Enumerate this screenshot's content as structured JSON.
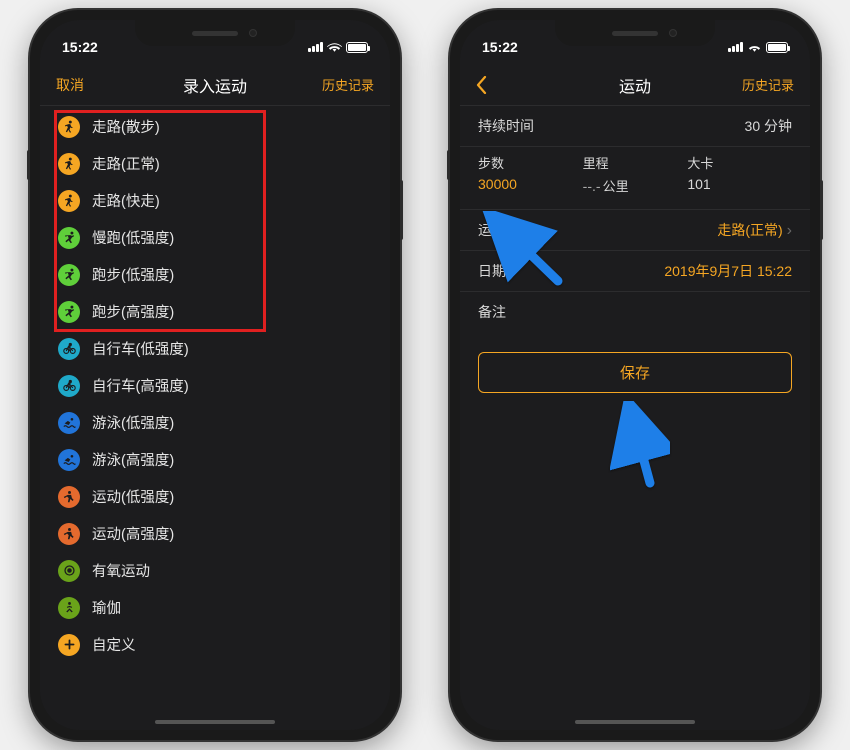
{
  "statusbar": {
    "time": "15:22",
    "location_dot": "↗"
  },
  "left": {
    "nav": {
      "cancel": "取消",
      "title": "录入运动",
      "history": "历史记录"
    },
    "items": [
      {
        "label": "走路(散步)",
        "color": "#f5a623",
        "glyph": "walk"
      },
      {
        "label": "走路(正常)",
        "color": "#f5a623",
        "glyph": "walk"
      },
      {
        "label": "走路(快走)",
        "color": "#f5a623",
        "glyph": "walk"
      },
      {
        "label": "慢跑(低强度)",
        "color": "#5fcf3a",
        "glyph": "run"
      },
      {
        "label": "跑步(低强度)",
        "color": "#5fcf3a",
        "glyph": "run"
      },
      {
        "label": "跑步(高强度)",
        "color": "#5fcf3a",
        "glyph": "run"
      },
      {
        "label": "自行车(低强度)",
        "color": "#1fa9c9",
        "glyph": "bike"
      },
      {
        "label": "自行车(高强度)",
        "color": "#1fa9c9",
        "glyph": "bike"
      },
      {
        "label": "游泳(低强度)",
        "color": "#2174d9",
        "glyph": "swim"
      },
      {
        "label": "游泳(高强度)",
        "color": "#2174d9",
        "glyph": "swim"
      },
      {
        "label": "运动(低强度)",
        "color": "#e46a2e",
        "glyph": "exercise"
      },
      {
        "label": "运动(高强度)",
        "color": "#e46a2e",
        "glyph": "exercise"
      },
      {
        "label": "有氧运动",
        "color": "#6aa31a",
        "glyph": "target"
      },
      {
        "label": "瑜伽",
        "color": "#6aa31a",
        "glyph": "yoga"
      },
      {
        "label": "自定义",
        "color": "#f5a623",
        "glyph": "plus"
      }
    ],
    "highlight_count": 6
  },
  "right": {
    "nav": {
      "back": "",
      "title": "运动",
      "history": "历史记录"
    },
    "duration": {
      "label": "持续时间",
      "value": "30 分钟"
    },
    "stats": {
      "steps": {
        "label": "步数",
        "value": "30000"
      },
      "distance": {
        "label": "里程",
        "value": "--.-",
        "unit": "公里"
      },
      "calories": {
        "label": "大卡",
        "value": "101"
      }
    },
    "type": {
      "label": "运动类型",
      "value": "走路(正常)"
    },
    "date": {
      "label": "日期",
      "value": "2019年9月7日 15:22"
    },
    "note": {
      "label": "备注"
    },
    "save": "保存"
  }
}
